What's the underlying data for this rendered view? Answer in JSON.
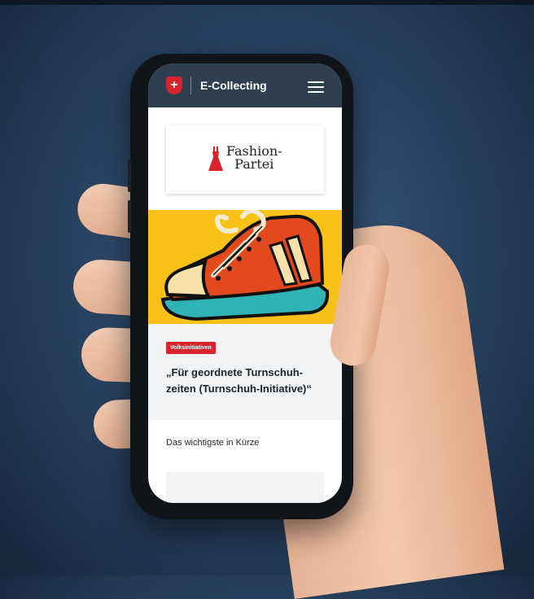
{
  "app_bar": {
    "title": "E-Collecting",
    "flag_icon": "swiss-flag-icon",
    "menu_icon": "hamburger-menu-icon"
  },
  "logo": {
    "line1": "Fashion-",
    "line2": "Partei",
    "icon": "dress-icon"
  },
  "hero": {
    "image": "red-sneaker-illustration",
    "background": "#f7c117"
  },
  "article": {
    "badge": "Volksinitiativen",
    "title": "„Für geordnete Turnschuh-zeiten (Turnschuh-Initiative)“"
  },
  "section": {
    "label": "Das wichtigste in Kürze"
  },
  "colors": {
    "header": "#2e3f51",
    "accent": "#d8232a"
  }
}
